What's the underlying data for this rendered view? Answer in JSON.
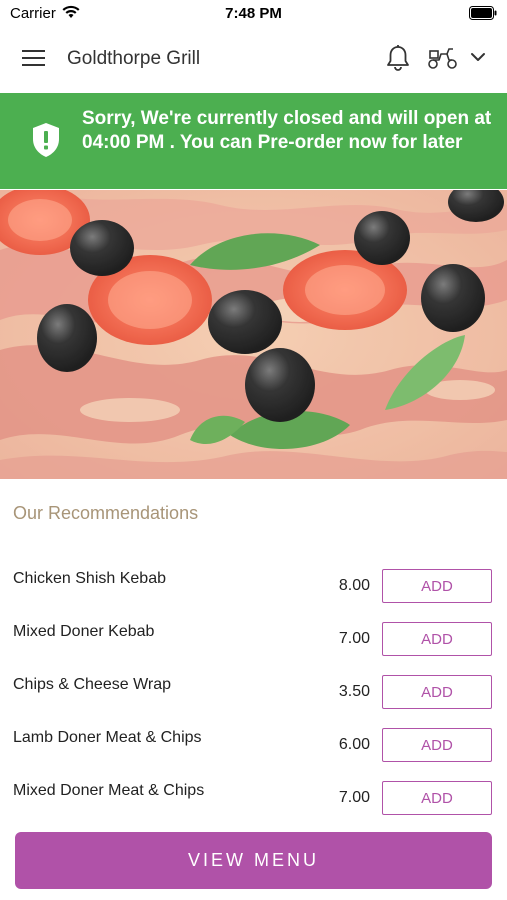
{
  "status_bar": {
    "carrier": "Carrier",
    "time": "7:48 PM",
    "icons": [
      "wifi-icon",
      "battery-icon"
    ]
  },
  "header": {
    "title": "Goldthorpe Grill",
    "icons": [
      "hamburger-menu-icon",
      "bell-icon",
      "scooter-icon",
      "chevron-down-icon"
    ]
  },
  "banner": {
    "message": "Sorry, We're currently closed and will open at 04:00 PM . You can Pre-order now for later",
    "icon": "shield-alert-icon",
    "color": "#4caf50"
  },
  "hero": {
    "icon": "pizza-photo"
  },
  "recommendations": {
    "title": "Our Recommendations",
    "items": [
      {
        "name": "Chicken Shish Kebab",
        "price": "8.00",
        "button": "ADD"
      },
      {
        "name": "Mixed Doner Kebab",
        "price": "7.00",
        "button": "ADD"
      },
      {
        "name": "Chips & Cheese Wrap",
        "price": "3.50",
        "button": "ADD"
      },
      {
        "name": "Lamb Doner Meat & Chips",
        "price": "6.00",
        "button": "ADD"
      },
      {
        "name": "Mixed Doner Meat & Chips",
        "price": "7.00",
        "button": "ADD"
      }
    ]
  },
  "footer": {
    "view_menu_label": "VIEW MENU"
  },
  "colors": {
    "accent": "#b052a8",
    "banner": "#4caf50",
    "section_title": "#a89578"
  }
}
